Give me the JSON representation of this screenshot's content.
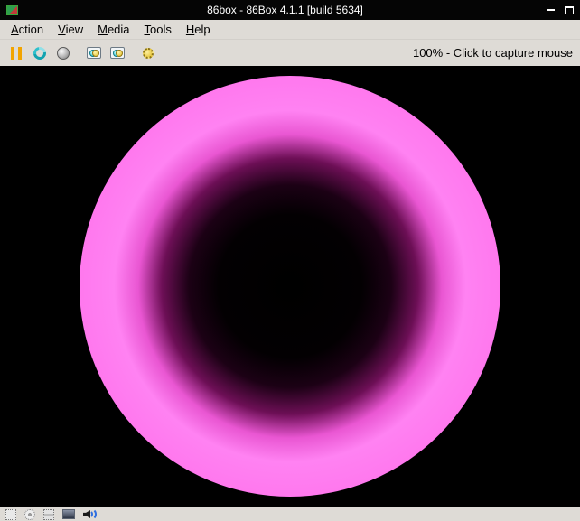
{
  "window": {
    "title": "86box - 86Box 4.1.1 [build 5634]",
    "controls": [
      "minimize",
      "maximize"
    ],
    "app_icon": "86box-logo"
  },
  "menubar": {
    "items": [
      {
        "name": "action",
        "accel": "A",
        "rest": "ction"
      },
      {
        "name": "view",
        "accel": "V",
        "rest": "iew"
      },
      {
        "name": "media",
        "accel": "M",
        "rest": "edia"
      },
      {
        "name": "tools",
        "accel": "T",
        "rest": "ools"
      },
      {
        "name": "help",
        "accel": "H",
        "rest": "elp"
      }
    ]
  },
  "toolbar": {
    "icons": [
      "pause",
      "hard-reset",
      "acpi-shutdown",
      "ctrl-alt-del",
      "ctrl-alt-esc",
      "settings"
    ],
    "zoom_text": "100% - Click to capture mouse"
  },
  "screen": {
    "content": "glowing pink torus rendered on black background",
    "colors": {
      "background": "#000000",
      "torus_bright": "#ff82f2",
      "torus_mid": "#e956d2",
      "torus_dark": "#6d0f56"
    }
  },
  "statusbar": {
    "icons": [
      "floppy-drive",
      "cdrom-drive",
      "removable-disk",
      "hard-disk",
      "sound"
    ]
  },
  "colors": {
    "chrome_bg": "#dedbd6",
    "titlebar_bg": "#050505",
    "titlebar_text": "#ffffff",
    "pause_icon": "#f2a400",
    "sound_wave": "#2f6fe0"
  }
}
